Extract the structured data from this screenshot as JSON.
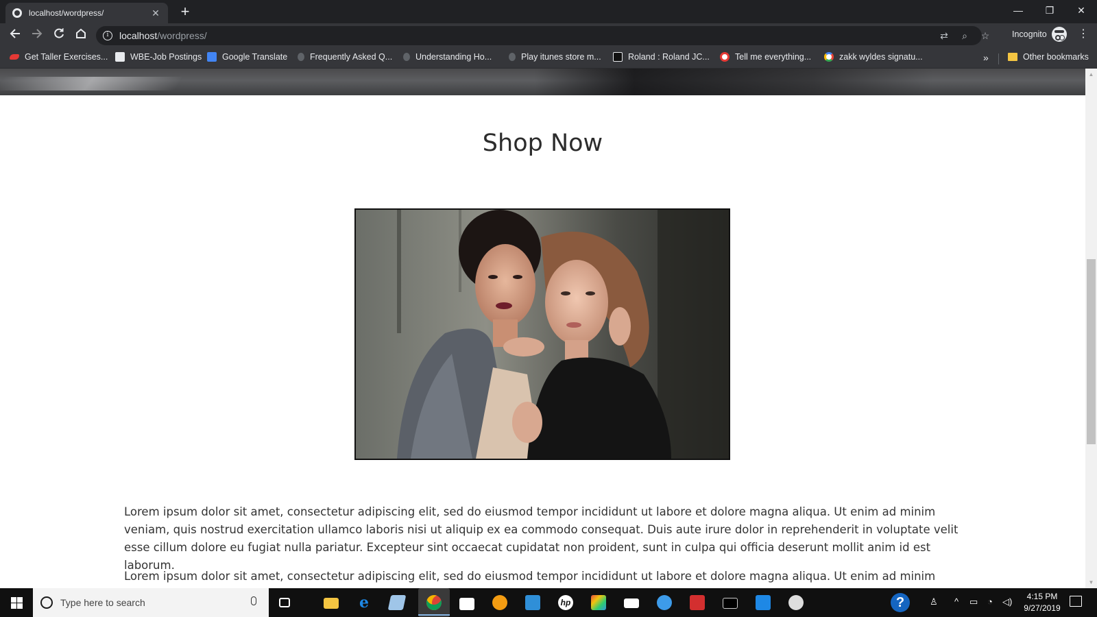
{
  "browser": {
    "tab": {
      "title": "localhost/wordpress/",
      "close_glyph": "✕",
      "icon": "globe-icon"
    },
    "new_tab_glyph": "+",
    "window_controls": {
      "minimize": "—",
      "restore": "❐",
      "close": "✕"
    },
    "address": {
      "host": "localhost",
      "path": "/wordpress/"
    },
    "profile_label": "Incognito",
    "bookmarks": [
      {
        "label": "Get Taller Exercises...",
        "icon": "running-shoe-icon",
        "color": "#e53935"
      },
      {
        "label": "WBE-Job Postings",
        "icon": "arrow-logo-icon",
        "color": "#e8eaed"
      },
      {
        "label": "Google Translate",
        "icon": "translate-icon",
        "color": "#4285f4"
      },
      {
        "label": "Frequently Asked Q...",
        "icon": "apple-icon",
        "color": "#5f6368"
      },
      {
        "label": "Understanding Ho...",
        "icon": "apple-icon",
        "color": "#5f6368"
      },
      {
        "label": "Play itunes store m...",
        "icon": "apple-icon",
        "color": "#5f6368"
      },
      {
        "label": "Roland : Roland JC...",
        "icon": "roland-icon",
        "color": "#111111"
      },
      {
        "label": "Tell me everything...",
        "icon": "target-icon",
        "color": "#e53935"
      },
      {
        "label": "zakk wyldes signatu...",
        "icon": "google-icon",
        "color": "#ffffff"
      }
    ],
    "bookmarks_more": "»",
    "other_bookmarks": "Other bookmarks"
  },
  "page": {
    "title": "Shop Now",
    "paragraphs": [
      "Lorem ipsum dolor sit amet, consectetur adipiscing elit, sed do eiusmod tempor incididunt ut labore et dolore magna aliqua. Ut enim ad minim veniam, quis nostrud exercitation ullamco laboris nisi ut aliquip ex ea commodo consequat. Duis aute irure dolor in reprehenderit in voluptate velit esse cillum dolore eu fugiat nulla pariatur. Excepteur sint occaecat cupidatat non proident, sunt in culpa qui officia deserunt mollit anim id est laborum.",
      "Lorem ipsum dolor sit amet, consectetur adipiscing elit, sed do eiusmod tempor incididunt ut labore et dolore magna aliqua. Ut enim ad minim veniam, quis"
    ]
  },
  "taskbar": {
    "search_placeholder": "Type here to search",
    "time": "4:15 PM",
    "date": "9/27/2019",
    "apps": [
      "file-explorer-icon",
      "edge-icon",
      "notes-icon",
      "chrome-icon",
      "store-icon",
      "vlc-icon",
      "dev-tool-icon",
      "hp-icon",
      "paint-icon",
      "mail-icon",
      "paper-plane-icon",
      "acrobat-icon",
      "terminal-icon",
      "vscode-icon",
      "github-icon"
    ]
  }
}
